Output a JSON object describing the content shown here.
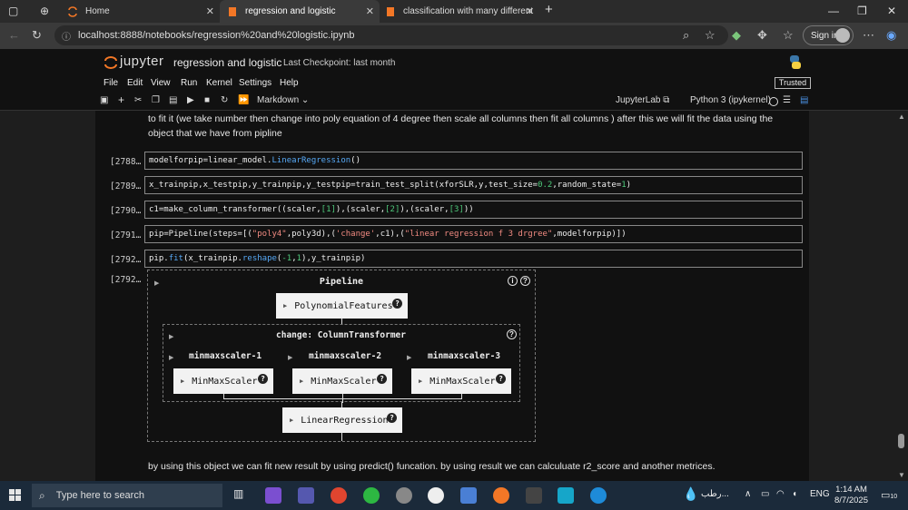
{
  "browser": {
    "tabs": [
      {
        "label": "Home"
      },
      {
        "label": "regression and logistic"
      },
      {
        "label": "classification with many different"
      }
    ],
    "url": "localhost:8888/notebooks/regression%20and%20logistic.ipynb",
    "signin_label": "Sign in"
  },
  "jupyter": {
    "brand": "jupyter",
    "notebook_title": "regression and logistic",
    "checkpoint": "Last Checkpoint: last month",
    "menu": [
      "File",
      "Edit",
      "View",
      "Run",
      "Kernel",
      "Settings",
      "Help"
    ],
    "trusted": "Trusted",
    "cell_type": "Markdown",
    "jupyterlab_label": "JupyterLab",
    "kernel_label": "Python 3 (ipykernel)"
  },
  "cells": {
    "md_top_line1": "to fit it (we take number then change into poly equation of 4 degree then scale all columns then fit all columns ) after this we will fit the data using the",
    "md_top_line2": "object that we have from pipline",
    "c1": {
      "prompt": "[2788…",
      "a": "modelforpip=linear_model.",
      "fn": "LinearRegression",
      "b": "()"
    },
    "c2": {
      "prompt": "[2789…",
      "a": "x_trainpip,x_testpip,y_trainpip,y_testpip=train_test_split(xforSLR,y,test_size=",
      "n1": "0.2",
      "b": ",random_state=",
      "n2": "1",
      "c": ")"
    },
    "c3": {
      "prompt": "[2790…",
      "a": "c1=make_column_transformer((scaler,",
      "n1": "[1]",
      "b": "),(scaler,",
      "n2": "[2]",
      "c": "),(scaler,",
      "n3": "[3]",
      "d": "))"
    },
    "c4": {
      "prompt": "[2791…",
      "a": "pip=Pipeline(steps=[(",
      "s1": "\"poly4\"",
      "b": ",poly3d),(",
      "s2": "'change'",
      "c": ",c1),(",
      "s3": "\"linear regression f 3 drgree\"",
      "d": ",modelforpip)])"
    },
    "c5": {
      "prompt": "[2792…",
      "a": "pip.",
      "fn1": "fit",
      "b": "(x_trainpip.",
      "fn2": "reshape",
      "c": "(",
      "n1": "-1",
      "d": ",",
      "n2": "1",
      "e": "),y_trainpip)"
    },
    "out_prompt": "[2792…",
    "md_bottom": "by using this object we can fit new result by using predict() funcation. by using result we can calculuate r2_score and another metrices."
  },
  "pipeline": {
    "title": "Pipeline",
    "step1": "PolynomialFeatures",
    "inner_title": "change: ColumnTransformer",
    "sub_labels": [
      "minmaxscaler-1",
      "minmaxscaler-2",
      "minmaxscaler-3"
    ],
    "scaler": "MinMaxScaler",
    "final": "LinearRegression"
  },
  "taskbar": {
    "search_placeholder": "Type here to search",
    "weather": "رطب...",
    "lang": "ENG",
    "time": "1:14 AM",
    "date": "8/7/2025",
    "notif_count": "10"
  }
}
